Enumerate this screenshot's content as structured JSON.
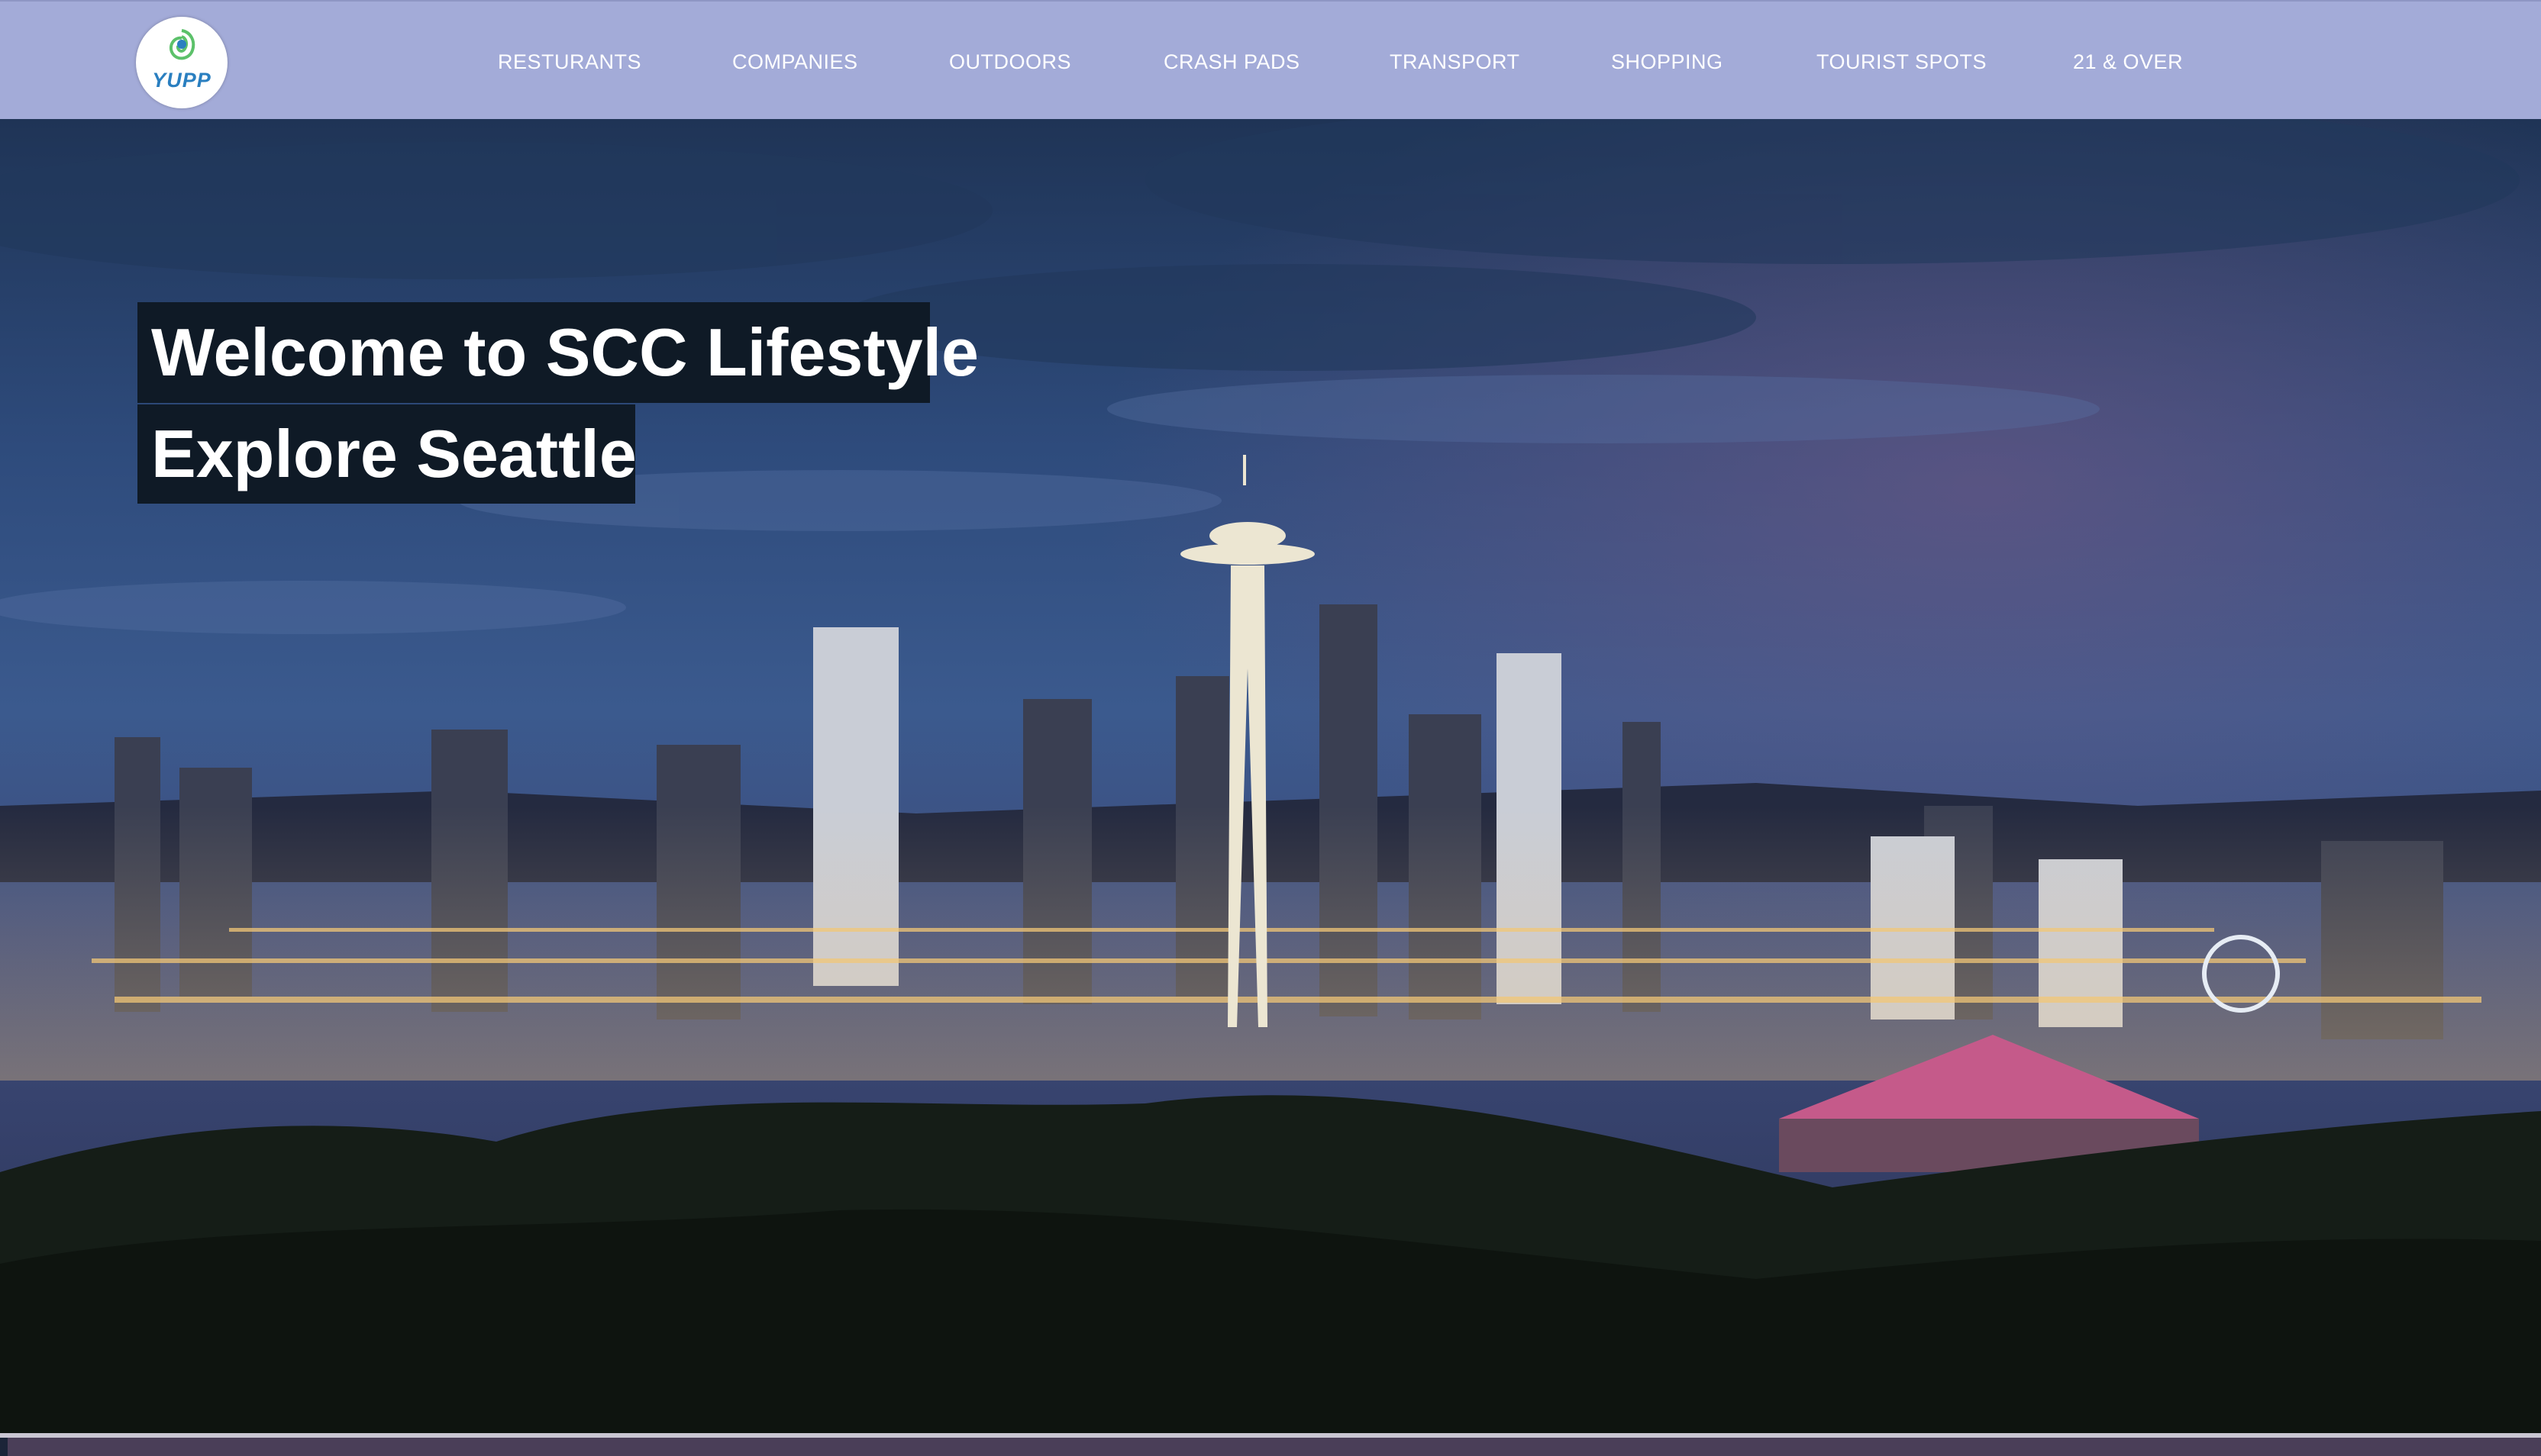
{
  "brand": {
    "logo_text": "YUPP",
    "colors": {
      "nav_bg": "#a3abd8",
      "logo_text": "#2a7fc0",
      "logo_mark": "#5cc16a",
      "headline_bg": "#0f1a26"
    }
  },
  "nav": {
    "items": [
      {
        "label": "RESTURANTS"
      },
      {
        "label": "COMPANIES"
      },
      {
        "label": "OUTDOORS"
      },
      {
        "label": "CRASH PADS"
      },
      {
        "label": "TRANSPORT"
      },
      {
        "label": "SHOPPING"
      },
      {
        "label": "TOURIST SPOTS"
      },
      {
        "label": "21 & OVER"
      }
    ]
  },
  "hero": {
    "headline_line1": "Welcome to SCC Lifestyle",
    "headline_line2": "Explore Seattle",
    "image_subject": "seattle-skyline-night-photo"
  }
}
